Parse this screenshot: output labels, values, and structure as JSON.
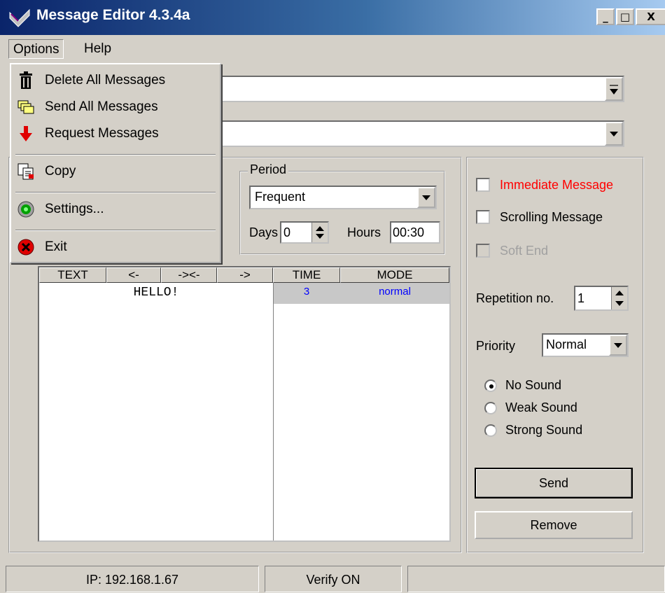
{
  "window": {
    "title": "Message Editor 4.3.4a"
  },
  "menubar": {
    "options": "Options",
    "help": "Help"
  },
  "options_menu": [
    {
      "label": "Delete All Messages",
      "icon": "trash-icon"
    },
    {
      "label": "Send All Messages",
      "icon": "send-all-icon"
    },
    {
      "label": "Request Messages",
      "icon": "request-arrow-icon"
    },
    {
      "label": "Copy",
      "icon": "copy-icon"
    },
    {
      "label": "Settings...",
      "icon": "settings-icon"
    },
    {
      "label": "Exit",
      "icon": "exit-icon"
    }
  ],
  "period": {
    "group_label": "Period",
    "selected": "Frequent",
    "days_label": "Days",
    "days_value": "0",
    "hours_label": "Hours",
    "hours_value": "00:30"
  },
  "table": {
    "columns": [
      "TEXT",
      "<-",
      "-><-",
      "->",
      "TIME",
      "MODE"
    ],
    "rows": [
      {
        "text": "HELLO!",
        "time": "3",
        "mode": "normal"
      }
    ]
  },
  "options_panel": {
    "immediate": "Immediate Message",
    "scrolling": "Scrolling Message",
    "soft_end": "Soft End",
    "repetition_label": "Repetition no.",
    "repetition_value": "1",
    "priority_label": "Priority",
    "priority_value": "Normal",
    "sounds": [
      "No Sound",
      "Weak Sound",
      "Strong Sound"
    ],
    "send": "Send",
    "remove": "Remove"
  },
  "status": {
    "ip": "IP: 192.168.1.67",
    "verify": "Verify ON"
  },
  "colors": {
    "immediate": "#ff0000",
    "table_row_blue": "#0000ff",
    "title_grad_start": "#0a246a"
  }
}
